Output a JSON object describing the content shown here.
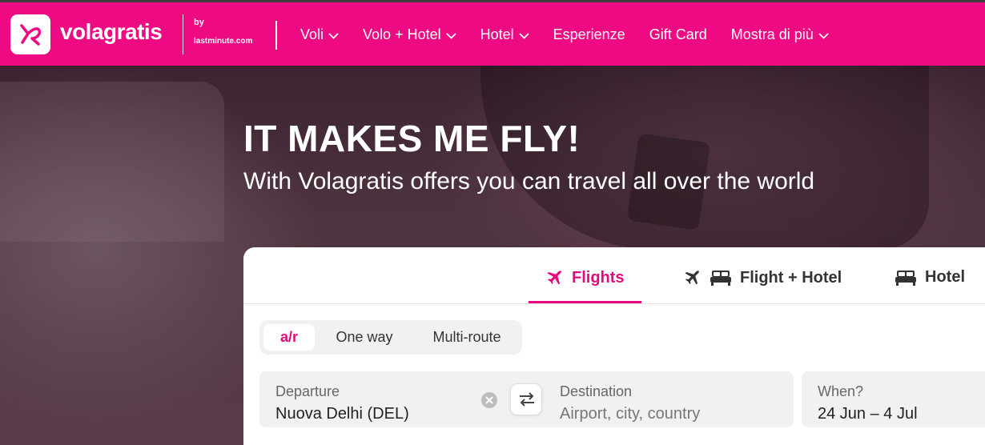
{
  "header": {
    "brand": "volagratis",
    "by": "by",
    "partner": "lastminute.com",
    "nav": [
      {
        "label": "Voli",
        "dropdown": true
      },
      {
        "label": "Volo + Hotel",
        "dropdown": true
      },
      {
        "label": "Hotel",
        "dropdown": true
      },
      {
        "label": "Esperienze",
        "dropdown": false
      },
      {
        "label": "Gift Card",
        "dropdown": false
      },
      {
        "label": "Mostra di più",
        "dropdown": true
      }
    ]
  },
  "hero": {
    "title": "IT MAKES ME FLY!",
    "subtitle": "With Volagratis offers you can travel all over the world"
  },
  "search": {
    "tabs": [
      {
        "label": "Flights",
        "icon": "plane-icon",
        "active": true
      },
      {
        "label": "Flight + Hotel",
        "icon": "plane-bed-icon",
        "active": false
      },
      {
        "label": "Hotel",
        "icon": "bed-icon",
        "active": false
      }
    ],
    "trip_types": [
      {
        "label": "a/r",
        "selected": true
      },
      {
        "label": "One way",
        "selected": false
      },
      {
        "label": "Multi-route",
        "selected": false
      }
    ],
    "departure": {
      "label": "Departure",
      "value": "Nuova Delhi (DEL)"
    },
    "destination": {
      "label": "Destination",
      "placeholder": "Airport, city, country"
    },
    "when": {
      "label": "When?",
      "value": "24 Jun – 4 Jul"
    }
  },
  "colors": {
    "brand": "#ee0a82",
    "accent": "#e40a7d"
  }
}
